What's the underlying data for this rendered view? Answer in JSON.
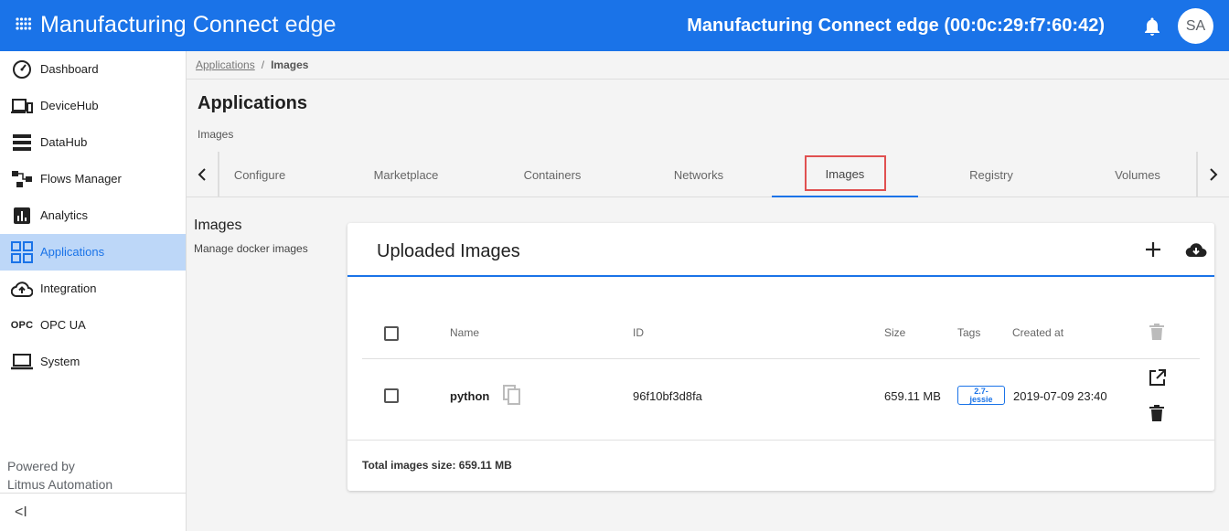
{
  "header": {
    "app_name": "Manufacturing Connect",
    "app_suffix": " edge",
    "device_title": "Manufacturing Connect edge (00:0c:29:f7:60:42)",
    "avatar_initials": "SA"
  },
  "sidebar": {
    "items": [
      {
        "label": "Dashboard",
        "icon": "speedometer-icon"
      },
      {
        "label": "DeviceHub",
        "icon": "devices-icon"
      },
      {
        "label": "DataHub",
        "icon": "server-icon"
      },
      {
        "label": "Flows Manager",
        "icon": "flow-icon"
      },
      {
        "label": "Analytics",
        "icon": "analytics-icon"
      },
      {
        "label": "Applications",
        "icon": "apps-grid-icon",
        "active": true
      },
      {
        "label": "Integration",
        "icon": "cloud-upload-icon"
      },
      {
        "label": "OPC UA",
        "icon": "opc-icon",
        "icon_text": "OPC"
      },
      {
        "label": "System",
        "icon": "laptop-icon"
      }
    ],
    "powered_line1": "Powered by",
    "powered_line2": "Litmus Automation",
    "collapse_glyph": "<I"
  },
  "breadcrumb": {
    "link": "Applications",
    "separator": "/",
    "current": "Images"
  },
  "page": {
    "title": "Applications",
    "subtitle": "Images"
  },
  "tabs": [
    {
      "label": "Configure"
    },
    {
      "label": "Marketplace"
    },
    {
      "label": "Containers"
    },
    {
      "label": "Networks"
    },
    {
      "label": "Images",
      "active": true
    },
    {
      "label": "Registry"
    },
    {
      "label": "Volumes"
    }
  ],
  "section": {
    "title": "Images",
    "description": "Manage docker images"
  },
  "card": {
    "title": "Uploaded Images",
    "columns": {
      "name": "Name",
      "id": "ID",
      "size": "Size",
      "tags": "Tags",
      "created": "Created at"
    },
    "rows": [
      {
        "name": "python",
        "id": "96f10bf3d8fa",
        "size": "659.11 MB",
        "tag_line1": "2.7-",
        "tag_line2": "jessie",
        "created": "2019-07-09 23:40"
      }
    ],
    "total": "Total images size: 659.11 MB"
  },
  "colors": {
    "primary": "#1a73e8",
    "active_nav_bg": "#bdd7f8",
    "highlight": "#e05050"
  }
}
